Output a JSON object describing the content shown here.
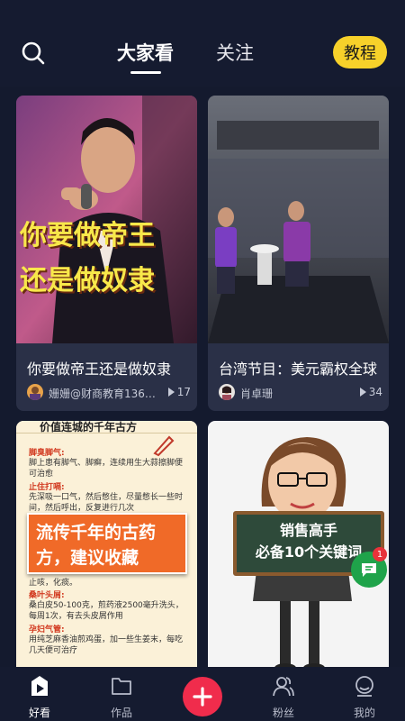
{
  "header": {
    "tabs": [
      {
        "label": "大家看",
        "active": true
      },
      {
        "label": "关注",
        "active": false
      }
    ],
    "tutorial_label": "教程"
  },
  "feed": [
    {
      "title": "你要做帝王还是做奴隶",
      "overlay_lines": [
        "你要做帝王",
        "还是做奴隶"
      ],
      "author": "姗姗@财商教育1368...",
      "plays": "17"
    },
    {
      "title": "台湾节目：美元霸权全球",
      "author": "肖卓珊",
      "plays": "34"
    },
    {
      "banner": "流传千年的古药方，建议收藏",
      "top_text": "价值连城的千年古方",
      "lines": [
        {
          "head": "脚臭脚气:",
          "text": "脚上患有脚气、脚癣，连续用生大蒜擦脚便可治愈"
        },
        {
          "head": "止住打嗝:",
          "text": "先深吸一口气，然后憋住，尽量憋长一些时间，然后呼出，反复进行几次"
        },
        {
          "text": "止咳，化痰。"
        },
        {
          "head": "桑叶头屑:",
          "text": "桑白皮50-100克，煎药液2500毫升洗头，每周1次，有去头皮屑作用"
        },
        {
          "head": "孕妇气管:",
          "text": "用纯芝麻香油煎鸡蛋，加一些生姜末，每吃几天便可治疗"
        }
      ]
    },
    {
      "board_text": [
        "销售高手",
        "必备10个关键词"
      ]
    }
  ],
  "message_badge_count": "1",
  "nav": [
    {
      "label": "好看",
      "active": true
    },
    {
      "label": "作品",
      "active": false
    },
    {
      "label": "粉丝",
      "active": false
    },
    {
      "label": "我的",
      "active": false
    }
  ],
  "colors": {
    "background": "#141a2e",
    "accent_yellow": "#f7d12a",
    "add_button": "#f02c4c",
    "badge_green": "#1fa34a"
  }
}
